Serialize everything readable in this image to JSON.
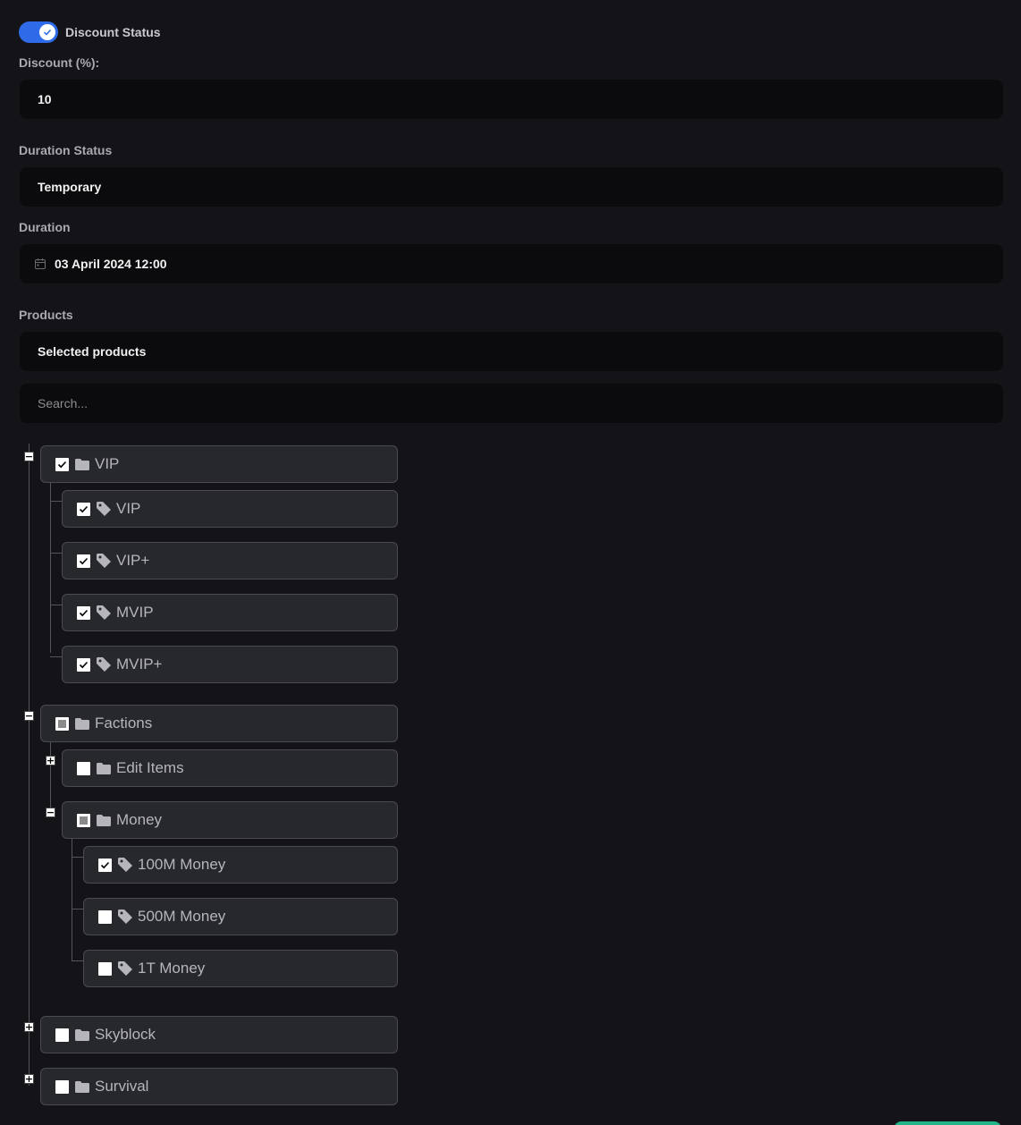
{
  "discount_status": {
    "label": "Discount Status",
    "enabled": true
  },
  "discount": {
    "label": "Discount (%):",
    "value": "10"
  },
  "duration_status": {
    "label": "Duration Status",
    "value": "Temporary"
  },
  "duration": {
    "label": "Duration",
    "value": "03 April 2024 12:00"
  },
  "products": {
    "label": "Products",
    "mode": "Selected products",
    "search_placeholder": "Search..."
  },
  "tree": {
    "vip": {
      "label": "VIP",
      "state": "checked",
      "expanded": true,
      "children": [
        {
          "label": "VIP",
          "state": "checked"
        },
        {
          "label": "VIP+",
          "state": "checked"
        },
        {
          "label": "MVIP",
          "state": "checked"
        },
        {
          "label": "MVIP+",
          "state": "checked"
        }
      ]
    },
    "factions": {
      "label": "Factions",
      "state": "partial",
      "expanded": true
    },
    "edit_items": {
      "label": "Edit Items",
      "state": "unchecked",
      "expanded": false
    },
    "money": {
      "label": "Money",
      "state": "partial",
      "expanded": true,
      "children": [
        {
          "label": "100M Money",
          "state": "checked"
        },
        {
          "label": "500M Money",
          "state": "unchecked"
        },
        {
          "label": "1T Money",
          "state": "unchecked"
        }
      ]
    },
    "skyblock": {
      "label": "Skyblock",
      "state": "unchecked",
      "expanded": false
    },
    "survival": {
      "label": "Survival",
      "state": "unchecked",
      "expanded": false
    }
  },
  "icons": {
    "folder": "folder-icon",
    "product": "tag-icon",
    "calendar": "calendar-icon",
    "check": "check-icon"
  },
  "colors": {
    "toggle": "#2f6ae8",
    "save_button": "#20b486",
    "background": "#141418"
  }
}
